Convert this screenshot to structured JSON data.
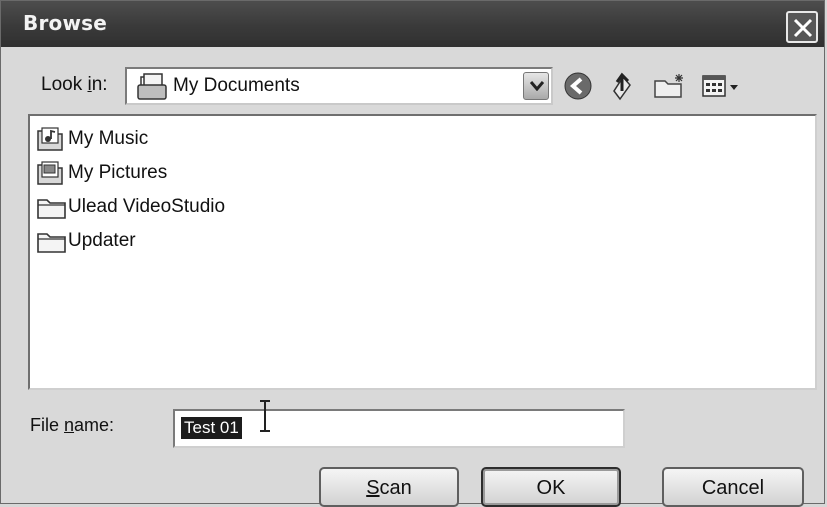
{
  "window": {
    "title": "Browse"
  },
  "lookin": {
    "label_pre": "Look ",
    "label_key": "i",
    "label_post": "n:",
    "value": "My Documents"
  },
  "toolbar": {
    "icons": [
      "back-icon",
      "up-folder-icon",
      "new-folder-icon",
      "view-menu-icon"
    ]
  },
  "files": [
    {
      "name": "My Music",
      "icon": "music-folder-icon"
    },
    {
      "name": "My Pictures",
      "icon": "pictures-folder-icon"
    },
    {
      "name": "Ulead VideoStudio",
      "icon": "folder-icon"
    },
    {
      "name": "Updater",
      "icon": "folder-icon"
    }
  ],
  "filename": {
    "label_pre": "File ",
    "label_key": "n",
    "label_post": "ame:",
    "value": "Test 01"
  },
  "buttons": {
    "scan_key": "S",
    "scan_rest": "can",
    "ok": "OK",
    "cancel": "Cancel"
  }
}
